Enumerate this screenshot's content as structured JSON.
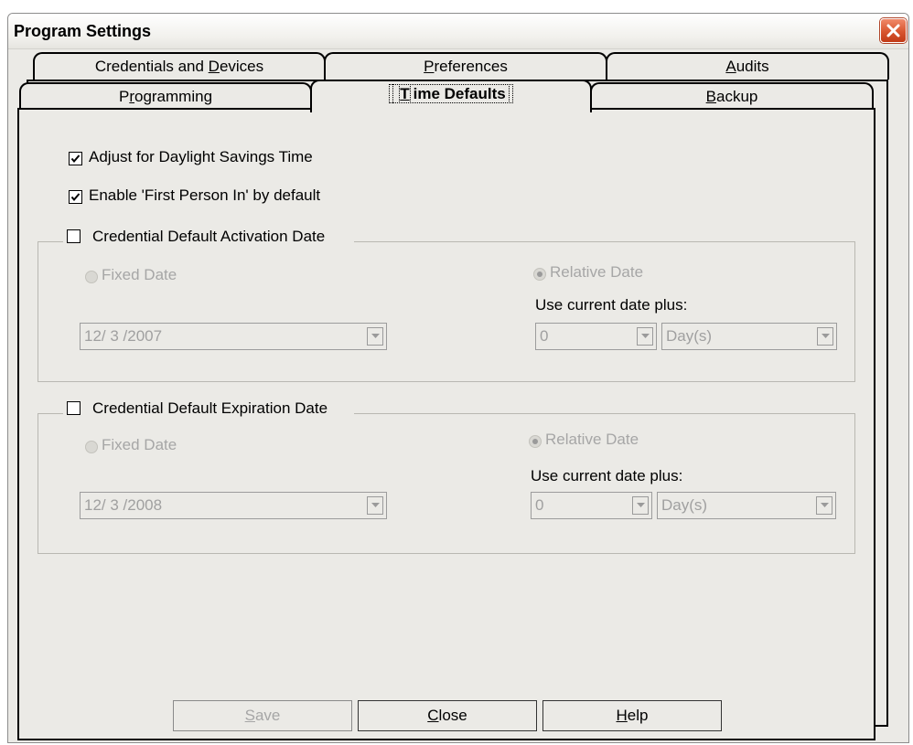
{
  "window": {
    "title": "Program Settings"
  },
  "tabs": {
    "back_row": [
      {
        "label_pre": "Credentials and ",
        "label_key": "D",
        "label_post": "evices"
      },
      {
        "label_pre": "",
        "label_key": "P",
        "label_post": "references"
      },
      {
        "label_pre": "",
        "label_key": "A",
        "label_post": "udits"
      }
    ],
    "front_row": [
      {
        "label_pre": "P",
        "label_key": "r",
        "label_post": "ogramming"
      },
      {
        "label_pre": "",
        "label_key": "T",
        "label_post": "ime Defaults"
      },
      {
        "label_pre": "",
        "label_key": "B",
        "label_post": "ackup"
      }
    ],
    "active": "Time Defaults"
  },
  "options": {
    "daylight": {
      "label": "Adjust for Daylight Savings Time",
      "checked": true
    },
    "first_person": {
      "label": "Enable 'First Person In' by default",
      "checked": true
    }
  },
  "activation": {
    "legend": "Credential Default Activation Date",
    "enabled": false,
    "fixed_label": "Fixed Date",
    "relative_label": "Relative Date",
    "relative_selected": true,
    "plus_label": "Use current date plus:",
    "date_value": "12/ 3 /2007",
    "amount_value": "0",
    "unit_value": "Day(s)"
  },
  "expiration": {
    "legend": "Credential Default Expiration Date",
    "enabled": false,
    "fixed_label": "Fixed Date",
    "relative_label": "Relative Date",
    "relative_selected": true,
    "plus_label": "Use current date plus:",
    "date_value": "12/ 3 /2008",
    "amount_value": "0",
    "unit_value": "Day(s)"
  },
  "buttons": {
    "save": {
      "key": "S",
      "rest": "ave",
      "enabled": false
    },
    "close": {
      "key": "C",
      "rest": "lose",
      "enabled": true
    },
    "help": {
      "key": "H",
      "rest": "elp",
      "enabled": true
    }
  },
  "colors": {
    "face": "#ebeae6",
    "close_button": "#d8552f",
    "disabled_text": "#a6a6a6"
  }
}
